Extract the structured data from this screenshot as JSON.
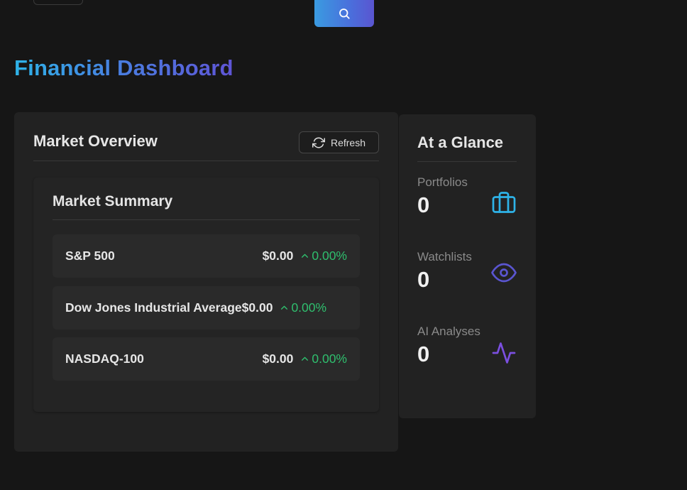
{
  "header": {
    "title": "Financial Dashboard",
    "search_icon": "search-icon"
  },
  "colors": {
    "background": "#161616",
    "card": "#222222",
    "positive": "#2fbf6e",
    "accent_cyan": "#2eb3e8",
    "accent_blue": "#4a6fdc",
    "accent_purple": "#7b4fe0"
  },
  "market_overview": {
    "title": "Market Overview",
    "refresh_label": "Refresh",
    "refresh_icon": "refresh-icon",
    "summary": {
      "title": "Market Summary",
      "indices": [
        {
          "name": "S&P 500",
          "price": "$0.00",
          "change": "0.00%"
        },
        {
          "name": "Dow Jones Industrial Average",
          "price": "$0.00",
          "change": "0.00%"
        },
        {
          "name": "NASDAQ-100",
          "price": "$0.00",
          "change": "0.00%"
        }
      ]
    }
  },
  "at_a_glance": {
    "title": "At a Glance",
    "stats": [
      {
        "label": "Portfolios",
        "value": "0",
        "icon": "briefcase-icon"
      },
      {
        "label": "Watchlists",
        "value": "0",
        "icon": "eye-icon"
      },
      {
        "label": "AI Analyses",
        "value": "0",
        "icon": "activity-icon"
      }
    ]
  }
}
